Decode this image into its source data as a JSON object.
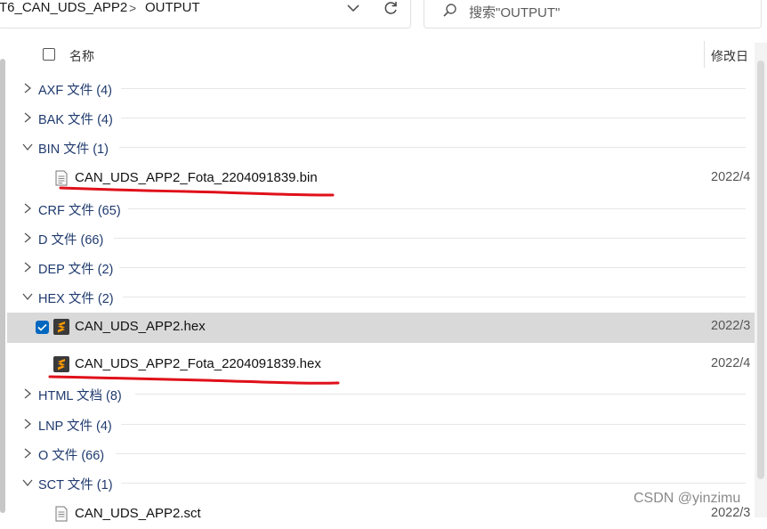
{
  "address_bar": {
    "crumbs": [
      "T6_CAN_UDS_APP2",
      "OUTPUT"
    ],
    "separator": ">",
    "icons": [
      "chevron-down-icon",
      "refresh-icon"
    ]
  },
  "search": {
    "placeholder": "搜索\"OUTPUT\"",
    "icon": "search-icon"
  },
  "columns": {
    "name": "名称",
    "date_modified": "修改日"
  },
  "groups": [
    {
      "label": "AXF 文件 (4)",
      "expanded": false
    },
    {
      "label": "BAK 文件 (4)",
      "expanded": false
    },
    {
      "label": "BIN 文件 (1)",
      "expanded": true,
      "files": [
        {
          "name": "CAN_UDS_APP2_Fota_2204091839.bin",
          "date": "2022/4",
          "icon": "document-icon",
          "selected": false,
          "underlined": true
        }
      ]
    },
    {
      "label": "CRF 文件 (65)",
      "expanded": false
    },
    {
      "label": "D 文件 (66)",
      "expanded": false
    },
    {
      "label": "DEP 文件 (2)",
      "expanded": false
    },
    {
      "label": "HEX 文件 (2)",
      "expanded": true,
      "files": [
        {
          "name": "CAN_UDS_APP2.hex",
          "date": "2022/3",
          "icon": "sublime-icon",
          "selected": true,
          "underlined": false
        },
        {
          "name": "CAN_UDS_APP2_Fota_2204091839.hex",
          "date": "2022/4",
          "icon": "sublime-icon",
          "selected": false,
          "underlined": true
        }
      ]
    },
    {
      "label": "HTML 文档 (8)",
      "expanded": false
    },
    {
      "label": "LNP 文件 (4)",
      "expanded": false
    },
    {
      "label": "O 文件 (66)",
      "expanded": false
    },
    {
      "label": "SCT 文件 (1)",
      "expanded": true,
      "files": [
        {
          "name": "CAN_UDS_APP2.sct",
          "date": "2022/3",
          "icon": "document-icon",
          "selected": false,
          "underlined": false
        }
      ]
    }
  ],
  "watermark": "CSDN @yinzimu",
  "colors": {
    "accent": "#0067c0",
    "selection": "#d9d9d9",
    "annotation": "#e0101a",
    "group_text": "#1f3a6e"
  }
}
